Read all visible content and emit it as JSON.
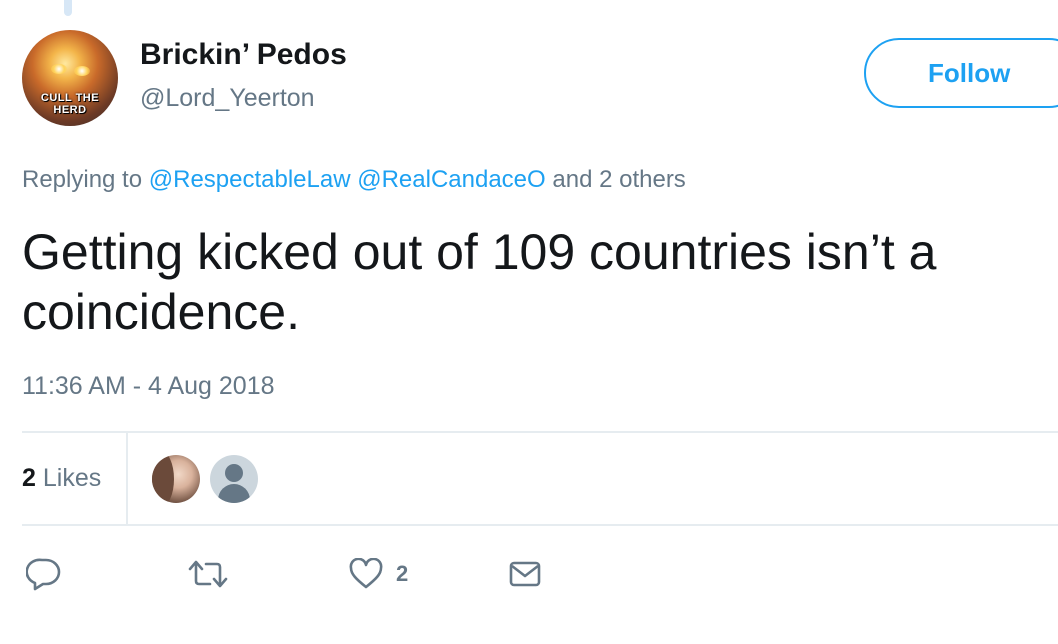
{
  "user": {
    "display_name": "Brickin’ Pedos",
    "handle": "@Lord_Yeerton",
    "avatar_badge_line1": "CULL THE",
    "avatar_badge_line2": "HERD"
  },
  "follow_button": {
    "label": "Follow"
  },
  "reply_context": {
    "prefix": "Replying to",
    "mention1": "@RespectableLaw",
    "mention2": "@RealCandaceO",
    "suffix": "and 2 others"
  },
  "tweet": {
    "text": "Getting kicked out of 109 countries isn’t a coincidence.",
    "timestamp": "11:36 AM - 4 Aug 2018"
  },
  "stats": {
    "likes_count": "2",
    "likes_label": "Likes"
  },
  "actions": {
    "like_count": "2",
    "icons": [
      "reply-icon",
      "retweet-icon",
      "heart-icon",
      "envelope-icon"
    ]
  },
  "colors": {
    "accent": "#1da1f2",
    "text_primary": "#14171a",
    "text_secondary": "#657786",
    "divider": "#e6ecf0"
  }
}
